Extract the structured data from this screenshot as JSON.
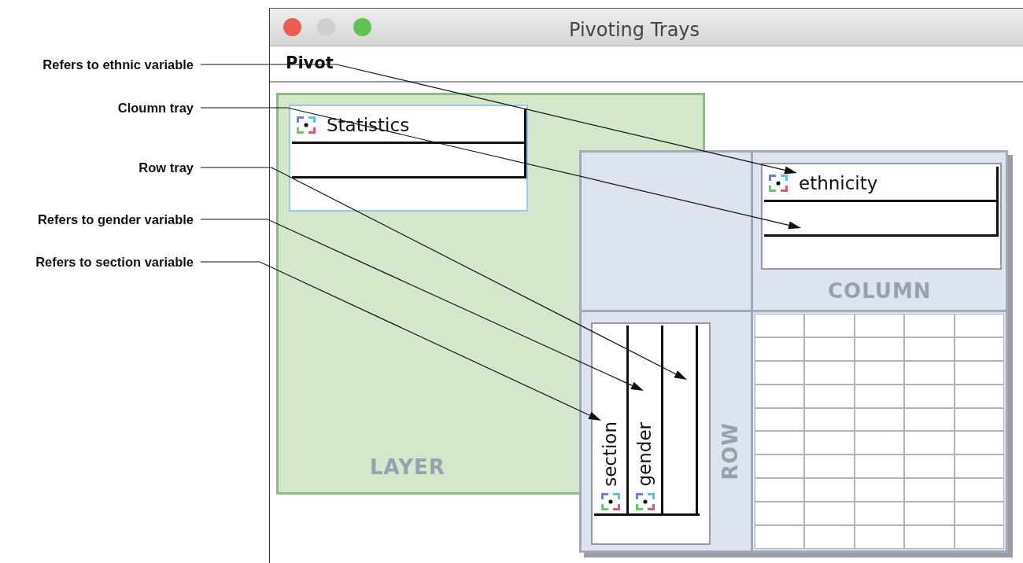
{
  "annotations": [
    {
      "text": "Refers to ethnic variable"
    },
    {
      "text": "Cloumn tray"
    },
    {
      "text": "Row tray"
    },
    {
      "text": "Refers to gender variable"
    },
    {
      "text": "Refers to section variable"
    }
  ],
  "window": {
    "title": "Pivoting Trays"
  },
  "menu": [
    "Pivot"
  ],
  "layer_tray": {
    "label": "LAYER",
    "items": [
      {
        "name": "Statistics"
      }
    ]
  },
  "column_tray": {
    "label": "COLUMN",
    "items": [
      {
        "name": "ethnicity"
      }
    ]
  },
  "row_tray": {
    "label": "ROW",
    "items": [
      {
        "name": "section"
      },
      {
        "name": "gender"
      }
    ]
  }
}
